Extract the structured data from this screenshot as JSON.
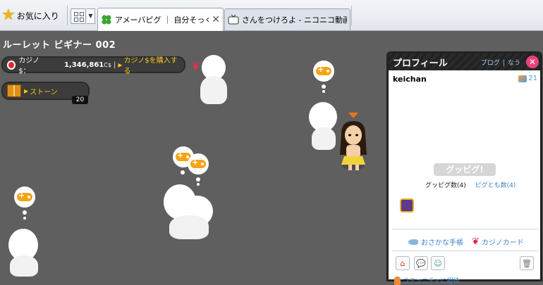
{
  "browser": {
    "favorites_label": "お気に入り",
    "tabs": [
      {
        "title": "アメーバピグ ｜ 自分そっく...",
        "active": true
      },
      {
        "title": "さんをつけろよ - ニコニコ動画(...",
        "active": false
      }
    ],
    "close_glyph": "✕"
  },
  "room": {
    "title": "ルーレット ビギナー 002"
  },
  "casino": {
    "label": "カジノ$：",
    "amount": "1,346,861",
    "unit": "C$",
    "buy_label": "カジノ$を購入する"
  },
  "stone": {
    "label": "ストーン",
    "count": "20"
  },
  "profile": {
    "header": "プロフィール",
    "link_blog": "ブログ",
    "link_nau": "なう",
    "link_sep": "|",
    "username": "keichan",
    "points": "21",
    "good_button": "グッピグ!",
    "good_count": "グッピグ数(4)",
    "friend_count": "ピグとも数(4)",
    "fish_link": "おさかな手帳",
    "casino_card": "カジノカード",
    "invite": "コミュニティに招待"
  },
  "colors": {
    "room_bg": "#5f5f5f",
    "accent_yellow": "#f4c318",
    "link_blue": "#3e86c8",
    "close_pink": "#e9447a",
    "gamepad_orange": "#f5a416"
  }
}
